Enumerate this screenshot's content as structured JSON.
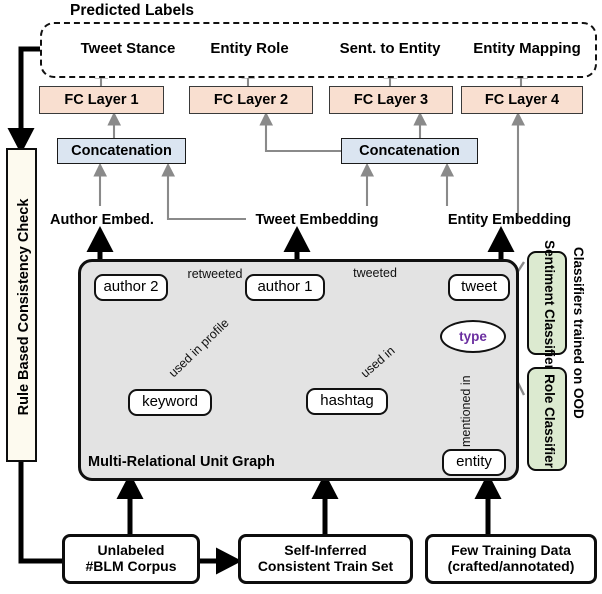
{
  "diagram": {
    "title": "Predicted Labels",
    "predicted_labels": [
      {
        "id": "tweet-stance",
        "label": "Tweet Stance"
      },
      {
        "id": "entity-role",
        "label": "Entity Role"
      },
      {
        "id": "sent-to-entity",
        "label": "Sent. to Entity"
      },
      {
        "id": "entity-mapping",
        "label": "Entity Mapping"
      }
    ],
    "fc_layers": [
      {
        "id": "fc-layer-1",
        "label": "FC Layer 1"
      },
      {
        "id": "fc-layer-2",
        "label": "FC Layer 2"
      },
      {
        "id": "fc-layer-3",
        "label": "FC Layer 3"
      },
      {
        "id": "fc-layer-4",
        "label": "FC Layer 4"
      }
    ],
    "concatenation": [
      {
        "id": "concat-left",
        "label": "Concatenation"
      },
      {
        "id": "concat-right",
        "label": "Concatenation"
      }
    ],
    "embeddings": [
      {
        "id": "author-embed",
        "label": "Author Embed."
      },
      {
        "id": "tweet-embedding",
        "label": "Tweet Embedding"
      },
      {
        "id": "entity-embedding",
        "label": "Entity Embedding"
      }
    ],
    "rule_check": {
      "label": "Rule Based Consistency Check"
    },
    "graph": {
      "caption": "Multi-Relational Unit Graph",
      "nodes": [
        {
          "id": "author-2",
          "label": "author 2"
        },
        {
          "id": "author-1",
          "label": "author 1"
        },
        {
          "id": "tweet",
          "label": "tweet"
        },
        {
          "id": "keyword",
          "label": "keyword"
        },
        {
          "id": "hashtag",
          "label": "hashtag"
        },
        {
          "id": "entity",
          "label": "entity"
        },
        {
          "id": "type",
          "label": "type"
        }
      ],
      "edges": [
        {
          "id": "retweeted",
          "label": "retweeted",
          "from": "author-2",
          "to": "author-1"
        },
        {
          "id": "tweeted",
          "label": "tweeted",
          "from": "author-1",
          "to": "tweet"
        },
        {
          "id": "used-in-profile",
          "label": "used in profile",
          "from": "keyword",
          "to": "author-1"
        },
        {
          "id": "used-in",
          "label": "used in",
          "from": "hashtag",
          "to": "tweet"
        },
        {
          "id": "mentioned-in",
          "label": "mentioned in",
          "from": "entity",
          "to": "tweet"
        }
      ]
    },
    "classifiers": {
      "group_label": "Classifiers trained on OOD",
      "items": [
        {
          "id": "sentiment-classifier",
          "line1": "Sentiment",
          "line2": "Classifier"
        },
        {
          "id": "role-classifier",
          "line1": "Role",
          "line2": "Classifier"
        }
      ]
    },
    "data_sources": [
      {
        "id": "unlabeled-corpus",
        "line1": "Unlabeled",
        "line2": "#BLM Corpus"
      },
      {
        "id": "self-inferred-train-set",
        "line1": "Self-Inferred",
        "line2": "Consistent Train Set"
      },
      {
        "id": "few-training-data",
        "line1": "Few Training Data",
        "line2": "(crafted/annotated)"
      }
    ],
    "colors": {
      "fc_layer_fill": "#f9dfd0",
      "concat_fill": "#dbe5f1",
      "classifier_fill": "#dcead0",
      "graph_panel_fill": "#e3e3e3",
      "rule_bar_fill": "#fdfaef",
      "type_text": "#6b2fa0",
      "thin_arrow": "#8a8a8a",
      "thick_arrow": "#000000"
    }
  }
}
